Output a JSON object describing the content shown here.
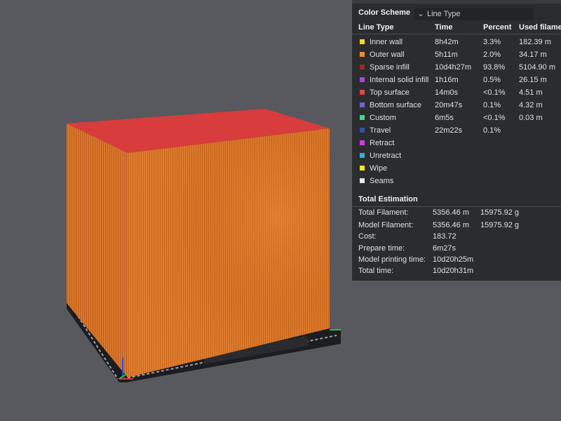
{
  "color_scheme": {
    "label": "Color Scheme",
    "selected": "Line Type"
  },
  "legend": {
    "headers": {
      "line_type": "Line Type",
      "time": "Time",
      "percent": "Percent",
      "used": "Used filame"
    },
    "rows": [
      {
        "name": "Inner wall",
        "time": "8h42m",
        "percent": "3.3%",
        "used": "182.39 m",
        "color": "#f2d33a"
      },
      {
        "name": "Outer wall",
        "time": "5h11m",
        "percent": "2.0%",
        "used": "34.17 m",
        "color": "#ef8c2c"
      },
      {
        "name": "Sparse infill",
        "time": "10d4h27m",
        "percent": "93.8%",
        "used": "5104.90 m",
        "color": "#9a2a2a"
      },
      {
        "name": "Internal solid infill",
        "time": "1h16m",
        "percent": "0.5%",
        "used": "26.15 m",
        "color": "#9b50cf"
      },
      {
        "name": "Top surface",
        "time": "14m0s",
        "percent": "<0.1%",
        "used": "4.51 m",
        "color": "#e04848"
      },
      {
        "name": "Bottom surface",
        "time": "20m47s",
        "percent": "0.1%",
        "used": "4.32 m",
        "color": "#6a62cf"
      },
      {
        "name": "Custom",
        "time": "6m5s",
        "percent": "<0.1%",
        "used": "0.03 m",
        "color": "#4fd086"
      },
      {
        "name": "Travel",
        "time": "22m22s",
        "percent": "0.1%",
        "used": "",
        "color": "#3350a8"
      },
      {
        "name": "Retract",
        "time": "",
        "percent": "",
        "used": "",
        "color": "#d43be0"
      },
      {
        "name": "Unretract",
        "time": "",
        "percent": "",
        "used": "",
        "color": "#3aaec8"
      },
      {
        "name": "Wipe",
        "time": "",
        "percent": "",
        "used": "",
        "color": "#f5e623"
      },
      {
        "name": "Seams",
        "time": "",
        "percent": "",
        "used": "",
        "color": "#e8e8e8"
      }
    ]
  },
  "estimation": {
    "title": "Total Estimation",
    "rows": [
      {
        "label": "Total Filament:",
        "v1": "5356.46 m",
        "v2": "15975.92 g"
      },
      {
        "label": "Model Filament:",
        "v1": "5356.46 m",
        "v2": "15975.92 g"
      },
      {
        "label": "Cost:",
        "v1": "183.72",
        "v2": ""
      },
      {
        "label": "Prepare time:",
        "v1": "6m27s",
        "v2": ""
      },
      {
        "label": "Model printing time:",
        "v1": "10d20h25m",
        "v2": ""
      },
      {
        "label": "Total time:",
        "v1": "10d20h31m",
        "v2": ""
      }
    ]
  },
  "colors": {
    "background": "#57595e",
    "panel": "#2b2c2e",
    "model_side": "#e07b2a",
    "model_top": "#d83c3c",
    "bed": "#1c1d20"
  }
}
